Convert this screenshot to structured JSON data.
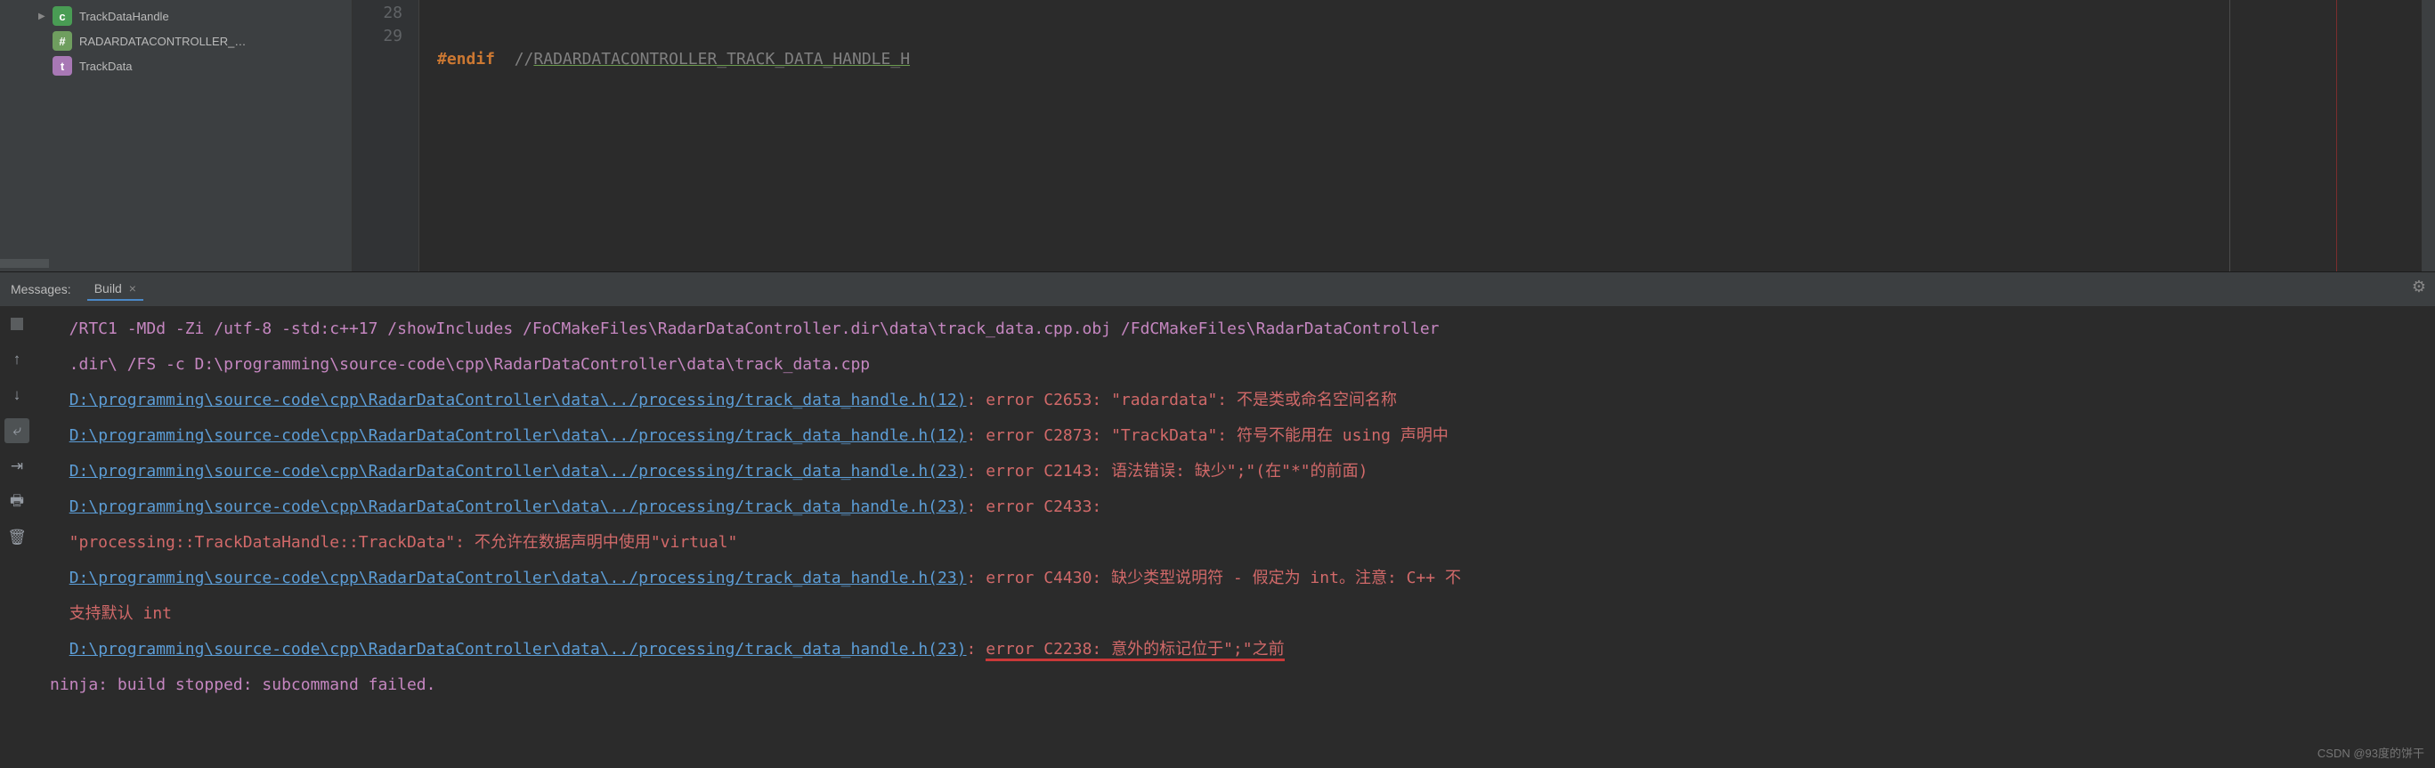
{
  "sidebar": {
    "items": [
      {
        "icon": "c",
        "label": "TrackDataHandle",
        "expandable": true
      },
      {
        "icon": "h",
        "label": "RADARDATACONTROLLER_…",
        "expandable": false
      },
      {
        "icon": "t",
        "label": "TrackData",
        "expandable": false
      }
    ]
  },
  "editor": {
    "gutter_lines": [
      "28",
      "29"
    ],
    "line28": {
      "keyword": "#endif",
      "comment_prefix": "  //",
      "comment_text": "RADARDATACONTROLLER_TRACK_DATA_HANDLE_H"
    }
  },
  "messages": {
    "label": "Messages:",
    "tab": "Build",
    "close": "×"
  },
  "console": {
    "compile_opts": "  /RTC1 -MDd -Zi /utf-8 -std:c++17 /showIncludes /FoCMakeFiles\\RadarDataController.dir\\data\\track_data.cpp.obj /FdCMakeFiles\\RadarDataController\n  .dir\\ /FS -c D:\\programming\\source-code\\cpp\\RadarDataController\\data\\track_data.cpp",
    "errors": [
      {
        "link": "D:\\programming\\source-code\\cpp\\RadarDataController\\data\\../processing/track_data_handle.h(12)",
        "msg": ": error C2653: \"radardata\": 不是类或命名空间名称"
      },
      {
        "link": "D:\\programming\\source-code\\cpp\\RadarDataController\\data\\../processing/track_data_handle.h(12)",
        "msg": ": error C2873: \"TrackData\": 符号不能用在 using 声明中"
      },
      {
        "link": "D:\\programming\\source-code\\cpp\\RadarDataController\\data\\../processing/track_data_handle.h(23)",
        "msg": ": error C2143: 语法错误: 缺少\";\"(在\"*\"的前面)"
      },
      {
        "link": "D:\\programming\\source-code\\cpp\\RadarDataController\\data\\../processing/track_data_handle.h(23)",
        "msg": ": error C2433:"
      }
    ],
    "inline_err": "  \"processing::TrackDataHandle::TrackData\": 不允许在数据声明中使用\"virtual\"",
    "error_wrap": {
      "link": "D:\\programming\\source-code\\cpp\\RadarDataController\\data\\../processing/track_data_handle.h(23)",
      "msg1": ": error C4430: 缺少类型说明符 - 假定为 int。注意: C++ 不",
      "msg2": "  支持默认 int"
    },
    "error_hi": {
      "link": "D:\\programming\\source-code\\cpp\\RadarDataController\\data\\../processing/track_data_handle.h(23)",
      "prefix": ": ",
      "hi": "error C2238: 意外的标记位于\";\"之前"
    },
    "final": "ninja: build stopped: subcommand failed."
  },
  "watermark": "CSDN @93度的饼干"
}
